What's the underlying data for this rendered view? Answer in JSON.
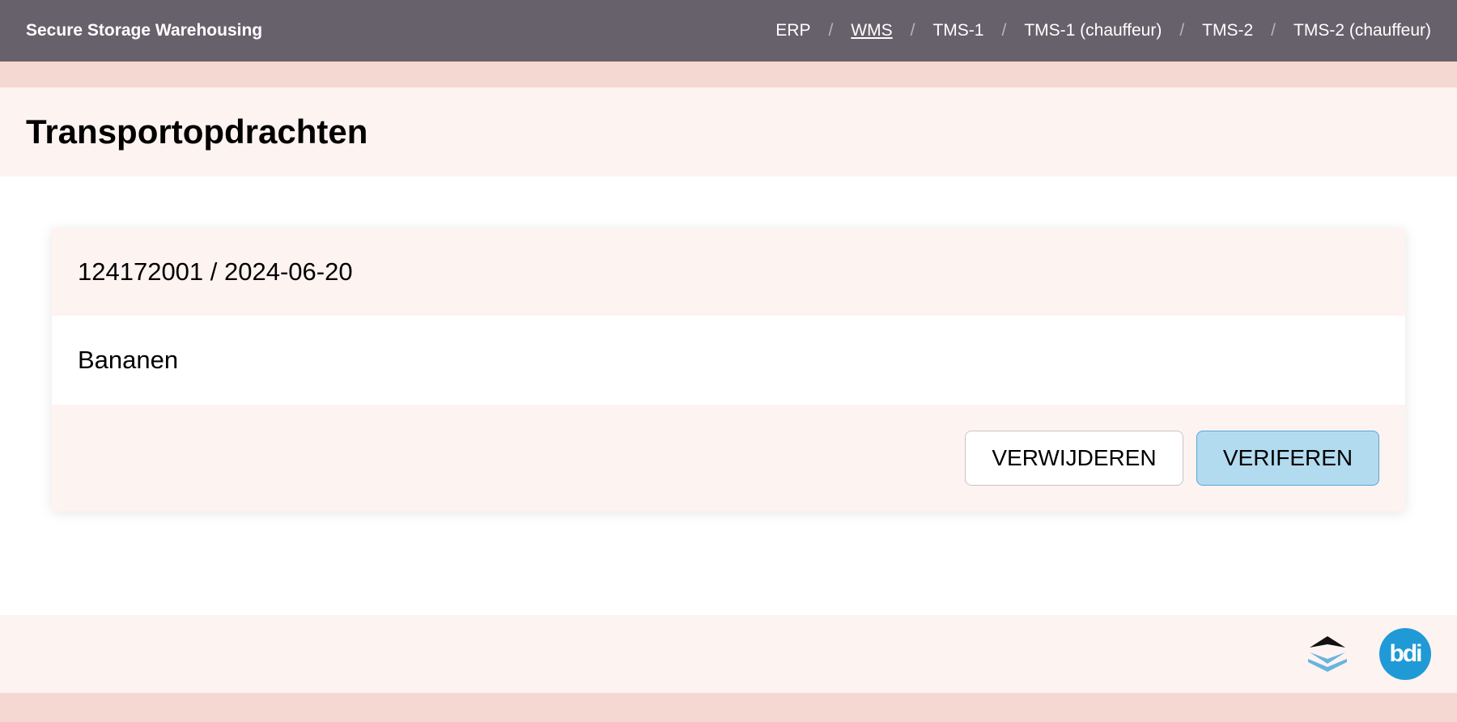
{
  "header": {
    "brand": "Secure Storage Warehousing",
    "nav": [
      "ERP",
      "WMS",
      "TMS-1",
      "TMS-1 (chauffeur)",
      "TMS-2",
      "TMS-2 (chauffeur)"
    ],
    "separator": "/",
    "active_item": "WMS"
  },
  "page": {
    "title": "Transportopdrachten"
  },
  "card": {
    "heading": "124172001 / 2024-06-20",
    "description": "Bananen",
    "delete_label": "VERWIJDEREN",
    "verify_label": "VERIFEREN"
  },
  "footer": {
    "logo_left": "layers-logo-icon",
    "logo_right_text": "bdi"
  },
  "colors": {
    "topbar": "#67616b",
    "band": "#f6d8d2",
    "panel": "#fdf3f1",
    "accent": "#b3dbef",
    "bdi_blue": "#1f9ad6"
  }
}
